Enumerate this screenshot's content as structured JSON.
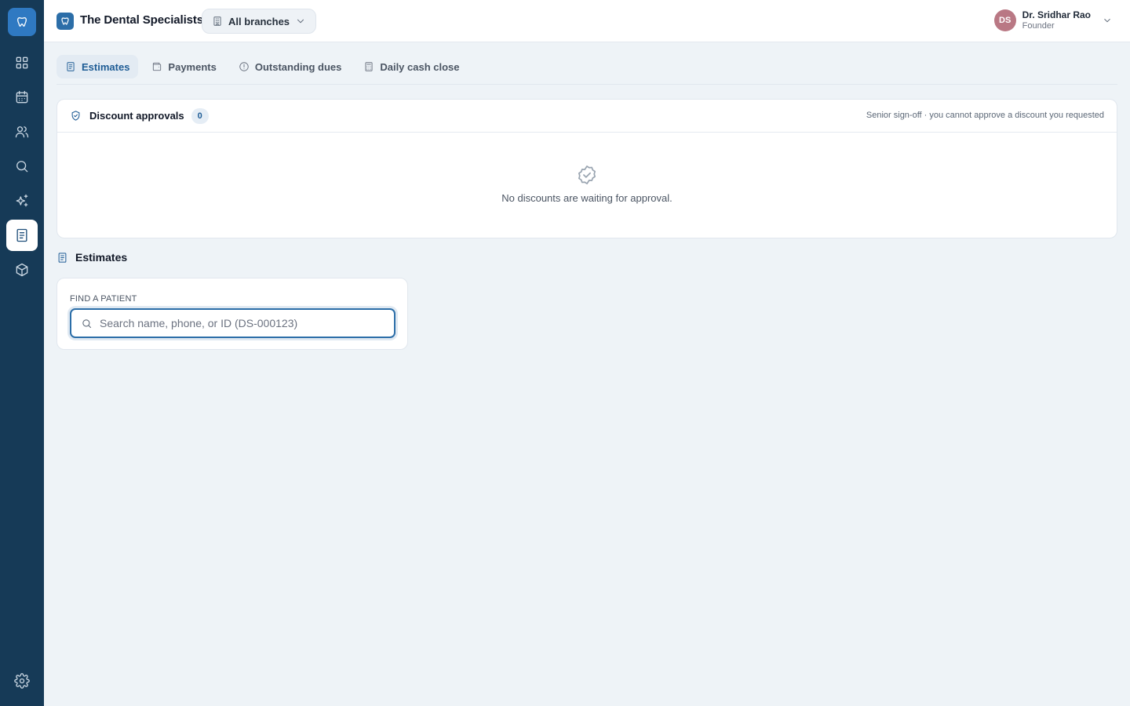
{
  "header": {
    "brand": "The Dental Specialists",
    "branch_selector": "All branches",
    "user": {
      "initials": "DS",
      "name": "Dr. Sridhar Rao",
      "role": "Founder"
    }
  },
  "sidebar": {
    "items": [
      {
        "icon": "dashboard-icon"
      },
      {
        "icon": "calendar-icon"
      },
      {
        "icon": "users-icon"
      },
      {
        "icon": "search-icon"
      },
      {
        "icon": "sparkles-icon"
      },
      {
        "icon": "billing-icon",
        "active": true
      },
      {
        "icon": "box-icon"
      },
      {
        "icon": "gear-icon"
      }
    ]
  },
  "tabs": [
    {
      "label": "Estimates",
      "active": true
    },
    {
      "label": "Payments"
    },
    {
      "label": "Outstanding dues"
    },
    {
      "label": "Daily cash close"
    }
  ],
  "discount_approvals": {
    "title": "Discount approvals",
    "count": "0",
    "note": "Senior sign-off · you cannot approve a discount you requested",
    "empty_text": "No discounts are waiting for approval."
  },
  "estimates": {
    "title": "Estimates",
    "find_label": "Find a patient",
    "search_placeholder": "Search name, phone, or ID (DS-000123)",
    "search_value": ""
  },
  "colors": {
    "sidebar": "#163a57",
    "accent": "#2c6ea8",
    "avatar": "#b97884",
    "background": "#eef3f7"
  }
}
